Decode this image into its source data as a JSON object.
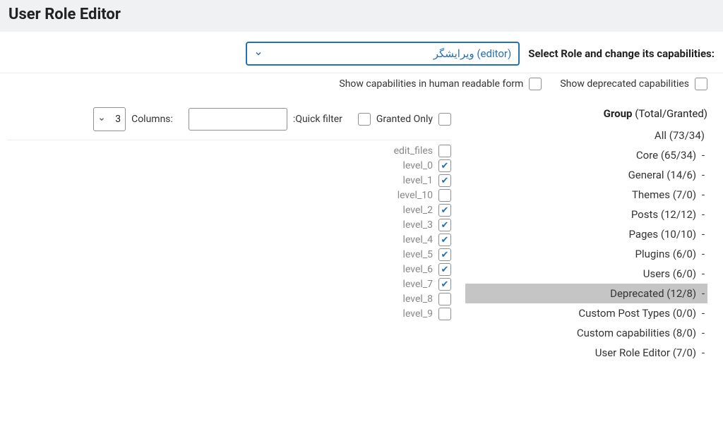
{
  "header": {
    "title": "User Role Editor"
  },
  "select_row": {
    "label": ":Select Role and change its capabilities",
    "role_value": "ویرایشگر (editor)"
  },
  "top_checks": {
    "deprecated_label": "Show deprecated capabilities",
    "human_label": "Show capabilities in human readable form"
  },
  "group_header": {
    "bold": "Group",
    "rest": " (Total/Granted)"
  },
  "groups": [
    {
      "label": "All (73/34)",
      "dash": false,
      "selected": false
    },
    {
      "label": "Core (65/34)",
      "dash": true,
      "selected": false
    },
    {
      "label": "General (14/6)",
      "dash": true,
      "selected": false
    },
    {
      "label": "Themes (7/0)",
      "dash": true,
      "selected": false
    },
    {
      "label": "Posts (12/12)",
      "dash": true,
      "selected": false
    },
    {
      "label": "Pages (10/10)",
      "dash": true,
      "selected": false
    },
    {
      "label": "Plugins (6/0)",
      "dash": true,
      "selected": false
    },
    {
      "label": "Users (6/0)",
      "dash": true,
      "selected": false
    },
    {
      "label": "Deprecated (12/8)",
      "dash": true,
      "selected": true
    },
    {
      "label": "Custom Post Types (0/0)",
      "dash": true,
      "selected": false
    },
    {
      "label": "Custom capabilities (8/0)",
      "dash": true,
      "selected": false
    },
    {
      "label": "User Role Editor (7/0)",
      "dash": true,
      "selected": false
    }
  ],
  "filter": {
    "granted_only_label": "Granted Only",
    "quick_filter_label": "Quick filter:",
    "columns_label": ":Columns",
    "columns_value": "3"
  },
  "caps": [
    {
      "label": "edit_files",
      "checked": false
    },
    {
      "label": "level_0",
      "checked": true
    },
    {
      "label": "level_1",
      "checked": true
    },
    {
      "label": "level_10",
      "checked": false
    },
    {
      "label": "level_2",
      "checked": true
    },
    {
      "label": "level_3",
      "checked": true
    },
    {
      "label": "level_4",
      "checked": true
    },
    {
      "label": "level_5",
      "checked": true
    },
    {
      "label": "level_6",
      "checked": true
    },
    {
      "label": "level_7",
      "checked": true
    },
    {
      "label": "level_8",
      "checked": false
    },
    {
      "label": "level_9",
      "checked": false
    }
  ]
}
